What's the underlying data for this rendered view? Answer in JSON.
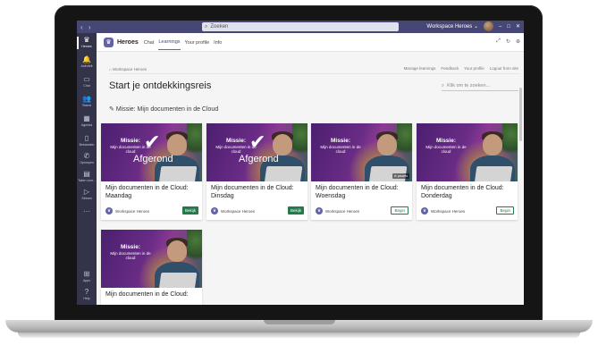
{
  "titlebar": {
    "nav": "‹ ›",
    "search_placeholder": "Zoeken",
    "org": "Workspace Heroes ⌄",
    "min": "–",
    "max": "□",
    "close": "✕"
  },
  "rail": [
    {
      "label": "Heroes",
      "glyph": "♛"
    },
    {
      "label": "Activiteit",
      "glyph": "🔔"
    },
    {
      "label": "Chat",
      "glyph": "▭"
    },
    {
      "label": "Teams",
      "glyph": "👥"
    },
    {
      "label": "Agenda",
      "glyph": "▦"
    },
    {
      "label": "Bestanden",
      "glyph": "▯"
    },
    {
      "label": "Oproepen",
      "glyph": "✆"
    },
    {
      "label": "Taken voor...",
      "glyph": "▤"
    },
    {
      "label": "Stream",
      "glyph": "▷"
    },
    {
      "label": "",
      "glyph": "···"
    },
    {
      "label": "Apps",
      "glyph": "⊞"
    },
    {
      "label": "Help",
      "glyph": "?"
    }
  ],
  "app": {
    "name": "Heroes",
    "tabs": [
      "Chat",
      "Learnings",
      "Your profile",
      "Info"
    ],
    "active_tab": "Learnings",
    "icons": [
      "⤢",
      "↻",
      "⊕"
    ]
  },
  "breadcrumb": {
    "home": "⌂  Workspace Heroes",
    "links": [
      "Manage learnings",
      "Feedback",
      "Your profile",
      "Logout from site"
    ]
  },
  "page": {
    "title": "Start je ontdekkingsreis",
    "search_placeholder": "Klik om te zoeken...",
    "section": "Missie: Mijn documenten in de Cloud"
  },
  "cards": [
    {
      "thumb_t1": "Missie:",
      "thumb_t2": "Mijn documenten in de cloud",
      "completed": true,
      "done_label": "Afgerond",
      "badge": "",
      "title": "Mijn documenten in de Cloud: Maandag",
      "publisher": "Workspace Heroes",
      "button": "Bekijk",
      "button_style": "solid"
    },
    {
      "thumb_t1": "Missie:",
      "thumb_t2": "Mijn documenten in de cloud",
      "completed": true,
      "done_label": "Afgerond",
      "badge": "",
      "title": "Mijn documenten in de Cloud: Dinsdag",
      "publisher": "Workspace Heroes",
      "button": "Bekijk",
      "button_style": "solid"
    },
    {
      "thumb_t1": "Missie:",
      "thumb_t2": "Mijn documenten in de cloud",
      "completed": false,
      "done_label": "",
      "badge": "⊘ pauzes",
      "title": "Mijn documenten in de Cloud: Woensdag",
      "publisher": "Workspace Heroes",
      "button": "Begin",
      "button_style": "outline"
    },
    {
      "thumb_t1": "Missie:",
      "thumb_t2": "Mijn documenten in de cloud",
      "completed": false,
      "done_label": "",
      "badge": "",
      "title": "Mijn documenten in de Cloud: Donderdag",
      "publisher": "Workspace Heroes",
      "button": "Begin",
      "button_style": "outline"
    },
    {
      "thumb_t1": "Missie:",
      "thumb_t2": "Mijn documenten in de cloud",
      "completed": false,
      "done_label": "",
      "badge": "",
      "title": "Mijn documenten in de Cloud:",
      "publisher": "",
      "button": "",
      "button_style": "none"
    }
  ],
  "colors": {
    "brand": "#6264a7",
    "rail": "#33344a",
    "titlebar": "#464775",
    "action_green": "#237b4b"
  }
}
